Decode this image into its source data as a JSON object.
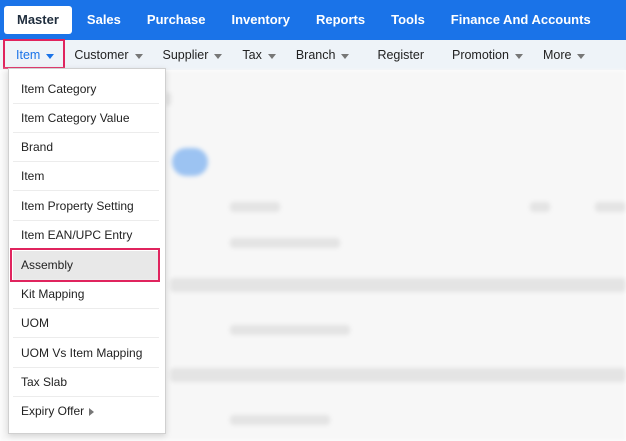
{
  "top_nav": [
    {
      "label": "Master",
      "active": true
    },
    {
      "label": "Sales"
    },
    {
      "label": "Purchase"
    },
    {
      "label": "Inventory"
    },
    {
      "label": "Reports"
    },
    {
      "label": "Tools"
    },
    {
      "label": "Finance And Accounts"
    }
  ],
  "sub_nav": [
    {
      "label": "Item",
      "active": true,
      "has_dropdown": true
    },
    {
      "label": "Customer",
      "has_dropdown": true
    },
    {
      "label": "Supplier",
      "has_dropdown": true
    },
    {
      "label": "Tax",
      "has_dropdown": true
    },
    {
      "label": "Branch",
      "has_dropdown": true
    },
    {
      "label": "Register",
      "has_dropdown": false
    },
    {
      "label": "Promotion",
      "has_dropdown": true
    },
    {
      "label": "More",
      "has_dropdown": true
    }
  ],
  "item_menu": [
    {
      "label": "Item Category"
    },
    {
      "label": "Item Category Value"
    },
    {
      "label": "Brand"
    },
    {
      "label": "Item"
    },
    {
      "label": "Item Property Setting"
    },
    {
      "label": "Item EAN/UPC Entry"
    },
    {
      "label": "Assembly",
      "highlighted": true
    },
    {
      "label": "Kit Mapping"
    },
    {
      "label": "UOM"
    },
    {
      "label": "UOM Vs Item Mapping"
    },
    {
      "label": "Tax Slab"
    },
    {
      "label": "Expiry Offer",
      "has_submenu": true
    }
  ],
  "colors": {
    "topbar": "#1a73e8",
    "subbar": "#eef3f8",
    "highlight": "#e0245e",
    "active_text": "#1a73e8"
  }
}
